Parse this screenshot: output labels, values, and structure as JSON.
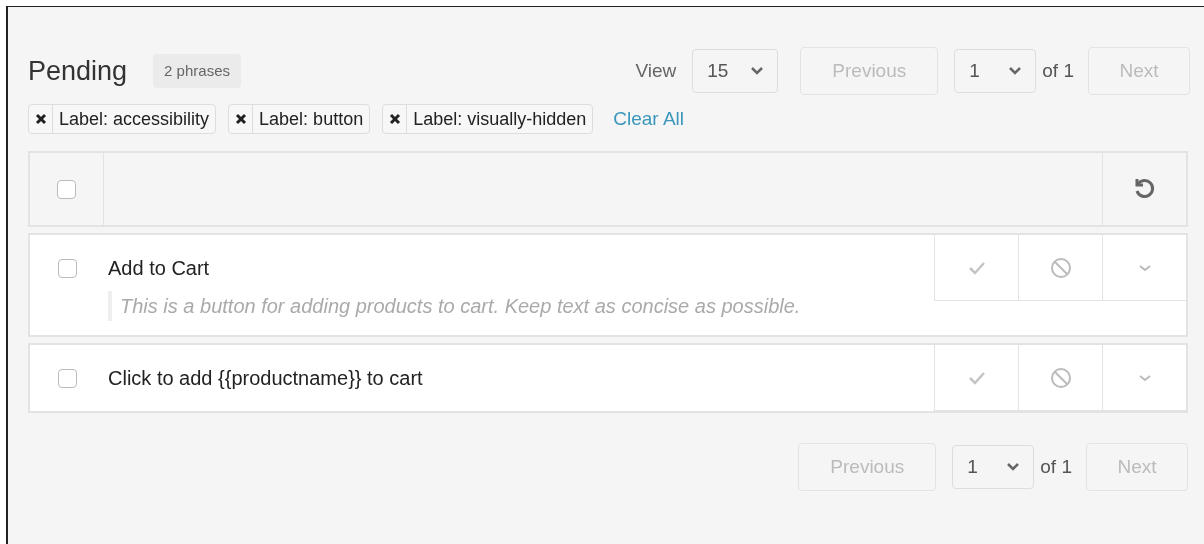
{
  "header": {
    "title": "Pending",
    "count_badge": "2 phrases"
  },
  "pagination_top": {
    "view_label": "View",
    "page_size": "15",
    "previous": {
      "label": "Previous",
      "disabled": true
    },
    "page": "1",
    "of_label": "of 1",
    "next": {
      "label": "Next",
      "disabled": true
    }
  },
  "filters": [
    {
      "label": "Label: accessibility"
    },
    {
      "label": "Label: button"
    },
    {
      "label": "Label: visually-hidden"
    }
  ],
  "clear_all": "Clear All",
  "table": {
    "select_all": {
      "checked": false
    },
    "rows": [
      {
        "text": "Add to Cart",
        "checked": false,
        "note": "This is a button for adding products to cart. Keep text as concise as possible."
      },
      {
        "text": "Click to add {{productname}} to cart",
        "checked": false
      }
    ]
  },
  "pagination_bottom": {
    "previous": {
      "label": "Previous",
      "disabled": true
    },
    "page": "1",
    "of_label": "of 1",
    "next": {
      "label": "Next",
      "disabled": true
    }
  }
}
